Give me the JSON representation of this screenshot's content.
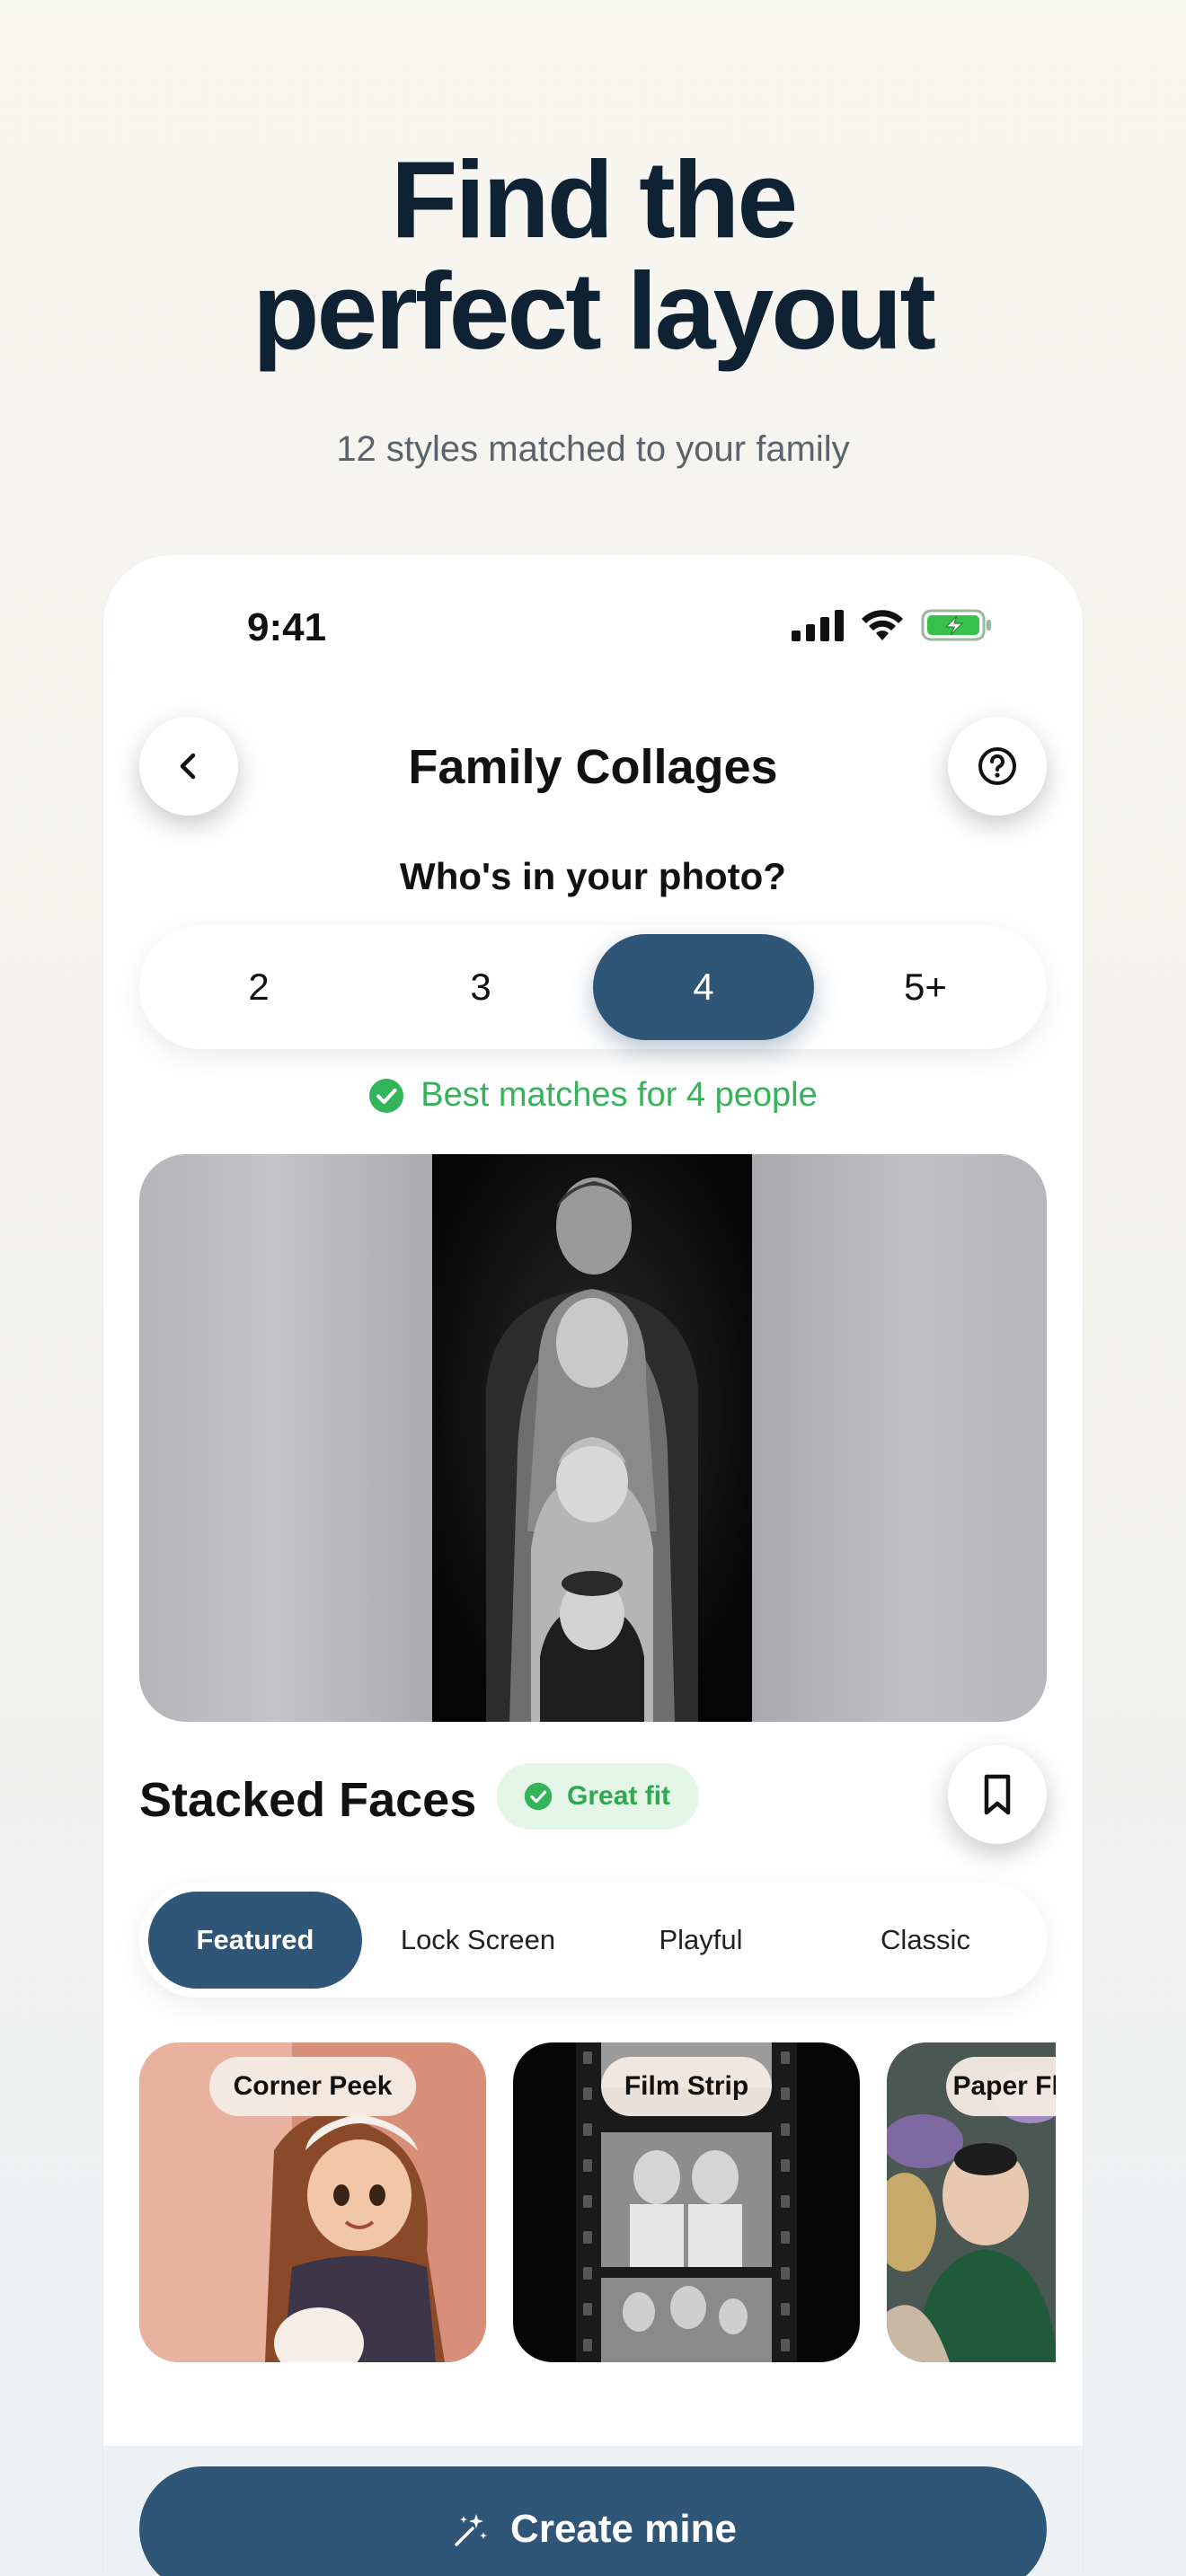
{
  "hero": {
    "title_line1": "Find the",
    "title_line2": "perfect layout",
    "subtitle": "12 styles matched to your family"
  },
  "status_bar": {
    "time": "9:41",
    "icons": [
      "signal-icon",
      "wifi-icon",
      "battery-charging-icon"
    ],
    "battery_color": "#36c24a"
  },
  "header": {
    "title": "Family Collages",
    "back_icon": "chevron-left-icon",
    "help_icon": "question-circle-icon"
  },
  "people_selector": {
    "question": "Who's in your photo?",
    "options": [
      "2",
      "3",
      "4",
      "5+"
    ],
    "selected": "4"
  },
  "match_note": {
    "icon": "check-circle-icon",
    "text": "Best matches for 4 people",
    "color": "#33b45a"
  },
  "preview": {
    "style_name": "Stacked Faces",
    "badge": "Great fit",
    "bookmark_icon": "bookmark-icon"
  },
  "filters": {
    "items": [
      "Featured",
      "Lock Screen",
      "Playful",
      "Classic"
    ],
    "selected": "Featured"
  },
  "cards": [
    {
      "label": "Corner Peek"
    },
    {
      "label": "Film Strip"
    },
    {
      "label": "Paper Flowers"
    }
  ],
  "cta": {
    "label": "Create mine",
    "icon": "magic-wand-icon"
  },
  "colors": {
    "accent": "#2f5577",
    "hero_text": "#0f2233",
    "success": "#33b45a"
  }
}
